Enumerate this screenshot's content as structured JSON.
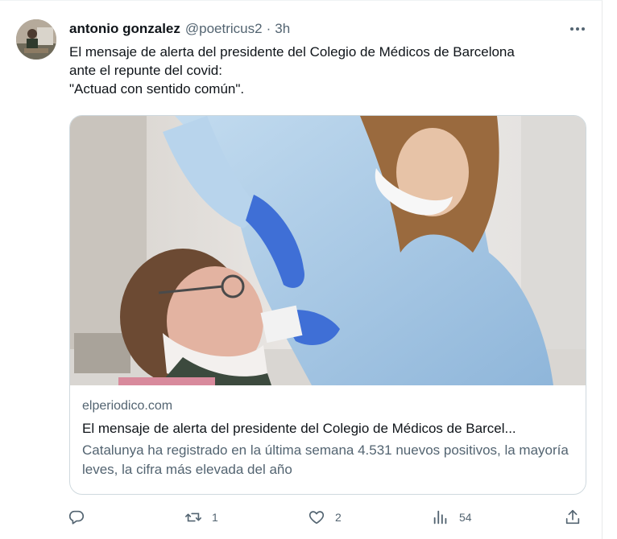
{
  "tweet": {
    "author_name": "antonio gonzalez",
    "author_handle": "@poetricus2",
    "separator": "·",
    "time": "3h",
    "text_lines": [
      "El mensaje de alerta del presidente del Colegio de Médicos de Barcelona",
      "ante el repunte del covid:",
      "\"Actuad con sentido común\"."
    ]
  },
  "card": {
    "domain": "elperiodico.com",
    "title": "El mensaje de alerta del presidente del Colegio de Médicos de Barcel...",
    "description": "Catalunya ha registrado en la última semana 4.531 nuevos positivos, la mayoría leves, la cifra más elevada del año"
  },
  "actions": {
    "reply_icon": "reply-icon",
    "retweet_icon": "retweet-icon",
    "retweet_count": "1",
    "like_icon": "heart-icon",
    "like_count": "2",
    "views_icon": "views-icon",
    "views_count": "54",
    "share_icon": "share-icon"
  },
  "colors": {
    "text_primary": "#0f1419",
    "text_secondary": "#536471",
    "border": "#cfd9de",
    "gown": "#a9c9e6",
    "glove": "#3f6fd6"
  }
}
